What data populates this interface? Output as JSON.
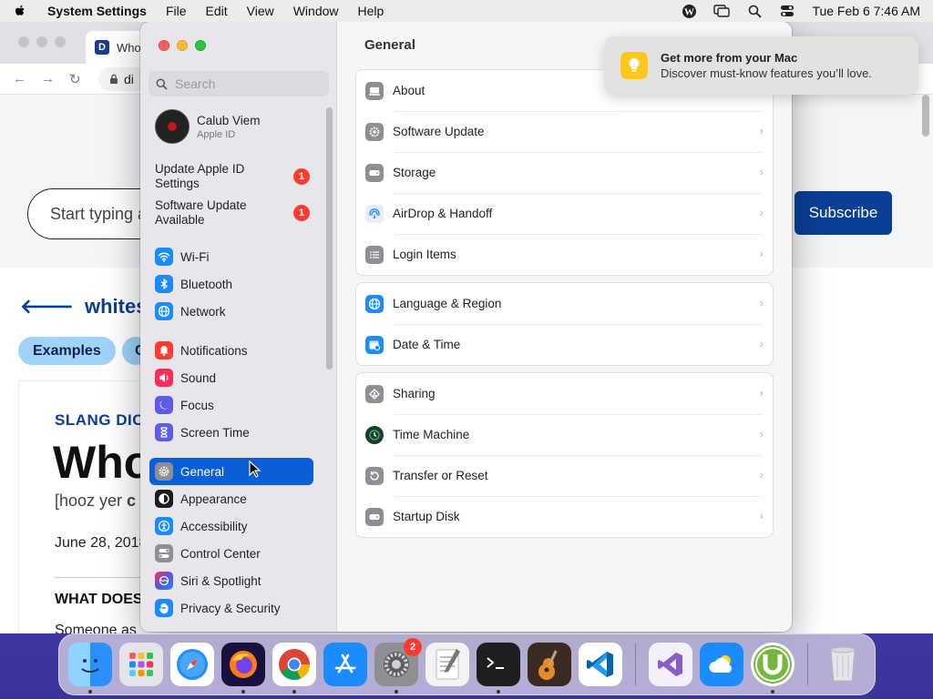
{
  "menubar": {
    "app_name": "System Settings",
    "menus": [
      "File",
      "Edit",
      "View",
      "Window",
      "Help"
    ],
    "clock": "Tue Feb 6  7:46 AM"
  },
  "browser": {
    "tab_title": "Who",
    "favicon_letter": "D",
    "address": "di",
    "search_placeholder": "Start typing a",
    "subscribe": "Subscribe",
    "back_link": "whitesplai",
    "pill_examples": "Examples",
    "pill_second": "C",
    "slang": "SLANG DIC",
    "headline": "Who",
    "pronunciation_prefix": "[hooz yer ",
    "pronunciation_bold": "c",
    "date": "June 28, 2018",
    "what_does": "WHAT DOES",
    "someone": "Someone as"
  },
  "settings": {
    "search_placeholder": "Search",
    "user": {
      "name": "Calub Viem",
      "sub": "Apple ID"
    },
    "notices": [
      {
        "label": "Update Apple ID Settings",
        "badge": "1"
      },
      {
        "label": "Software Update Available",
        "badge": "1"
      }
    ],
    "sidebar": [
      {
        "label": "Wi-Fi"
      },
      {
        "label": "Bluetooth"
      },
      {
        "label": "Network"
      },
      {
        "label": "Notifications"
      },
      {
        "label": "Sound"
      },
      {
        "label": "Focus"
      },
      {
        "label": "Screen Time"
      },
      {
        "label": "General"
      },
      {
        "label": "Appearance"
      },
      {
        "label": "Accessibility"
      },
      {
        "label": "Control Center"
      },
      {
        "label": "Siri & Spotlight"
      },
      {
        "label": "Privacy & Security"
      }
    ],
    "content_title": "General",
    "groups": [
      [
        "About",
        "Software Update",
        "Storage",
        "AirDrop & Handoff",
        "Login Items"
      ],
      [
        "Language & Region",
        "Date & Time"
      ],
      [
        "Sharing",
        "Time Machine",
        "Transfer or Reset",
        "Startup Disk"
      ]
    ]
  },
  "notification": {
    "title": "Get more from your Mac",
    "body": "Discover must-know features you’ll love."
  },
  "dock": {
    "system_settings_badge": "2"
  },
  "colors": {
    "accent": "#0a5fd8",
    "badge": "#ff3b30",
    "subscribe": "#0b3e97"
  }
}
